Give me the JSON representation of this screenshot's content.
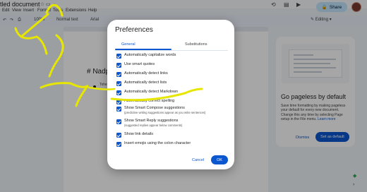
{
  "window": {
    "doc_title": "tled document",
    "menu": [
      "Edit",
      "View",
      "Insert",
      "Format",
      "Tools",
      "Extensions",
      "Help"
    ]
  },
  "header": {
    "share_label": "Share",
    "editing_label": "Editing"
  },
  "toolbar": {
    "zoom": "100%",
    "style": "Normal text",
    "font": "Arial"
  },
  "document": {
    "heading": "# Nadp",
    "bullet_text": "Tohe"
  },
  "side_panel": {
    "title": "Go pageless by default",
    "body": "Save time formatting by making pageless your default for every new document. Change this any time by selecting Page setup in the File menu.",
    "learn_more": "Learn more",
    "dismiss_label": "Dismiss",
    "default_label": "Set as default"
  },
  "dialog": {
    "title": "Preferences",
    "tabs": [
      "General",
      "Substitutions"
    ],
    "active_tab": "General",
    "options": [
      {
        "label": "Automatically capitalize words",
        "checked": true
      },
      {
        "label": "Use smart quotes",
        "checked": true
      },
      {
        "label": "Automatically detect links",
        "checked": true
      },
      {
        "label": "Automatically detect lists",
        "checked": true
      },
      {
        "label": "Automatically detect Markdown",
        "checked": true
      },
      {
        "label": "Automatically correct spelling",
        "checked": true
      },
      {
        "label": "Show Smart Compose suggestions",
        "sublabel": "(predictive writing suggestions appear as you write sentences)",
        "checked": true
      },
      {
        "label": "Show Smart Reply suggestions",
        "sublabel": "(suggested replies appear below comments)",
        "checked": true
      },
      {
        "label": "Show link details",
        "checked": true
      },
      {
        "label": "Insert emojis using the colon character",
        "checked": true
      }
    ],
    "cancel_label": "Cancel",
    "ok_label": "OK"
  },
  "colors": {
    "accent": "#0b57d0",
    "annotation": "#e6e600",
    "share_bg": "#c2e7ff"
  }
}
